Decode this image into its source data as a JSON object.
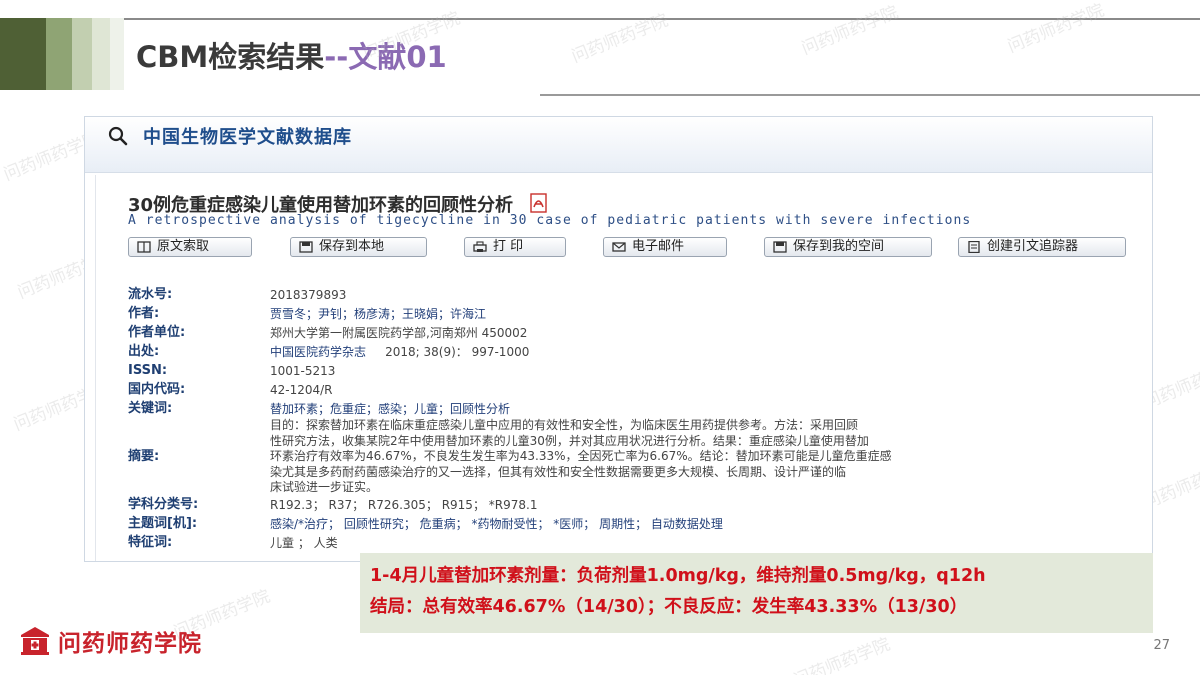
{
  "slide": {
    "title_main": "CBM检索结果",
    "title_sub": "--文献01",
    "page_number": "27",
    "watermark": "问药师药学院"
  },
  "database": {
    "title": "中国生物医学文献数据库"
  },
  "article": {
    "title_cn": "30例危重症感染儿童使用替加环素的回顾性分析",
    "title_en": "A retrospective analysis of tigecycline in 30 case of pediatric patients with severe infections"
  },
  "toolbar": {
    "buttons": [
      "原文索取",
      "保存到本地",
      "打 印",
      "电子邮件",
      "保存到我的空间",
      "创建引文追踪器"
    ]
  },
  "record": {
    "serial_label": "流水号:",
    "serial_value": "2018379893",
    "authors_label": "作者:",
    "authors_value": "贾雪冬；尹钊；杨彦涛；王晓娟；许海江",
    "affiliation_label": "作者单位:",
    "affiliation_value": "郑州大学第一附属医院药学部,河南郑州 450002",
    "source_label": "出处:",
    "source_journal": "中国医院药学杂志",
    "source_issue": "2018; 38(9)：  997-1000",
    "issn_label": "ISSN:",
    "issn_value": "1001-5213",
    "domestic_code_label": "国内代码:",
    "domestic_code_value": "42-1204/R",
    "keywords_label": "关键词:",
    "keywords_value": "替加环素；危重症；感染；儿童；回顾性分析",
    "abstract_label": "摘要:",
    "abstract_lines": [
      "目的：探索替加环素在临床重症感染儿童中应用的有效性和安全性，为临床医生用药提供参考。方法：采用回顾",
      "性研究方法，收集某院2年中使用替加环素的儿童30例，并对其应用状况进行分析。结果：重症感染儿童使用替加",
      "环素治疗有效率为46.67%，不良发生发生率为43.33%，全因死亡率为6.67%。结论：替加环素可能是儿童危重症感",
      "染尤其是多药耐药菌感染治疗的又一选择，但其有效性和安全性数据需要更多大规模、长周期、设计严谨的临",
      "床试验进一步证实。"
    ],
    "classification_label": "学科分类号:",
    "classification_value": "R192.3；  R37；  R726.305；  R915；  *R978.1",
    "subject_label": "主题词[机]:",
    "subject_value": "感染/*治疗；  回顾性研究；  危重病；  *药物耐受性；  *医师；  周期性；  自动数据处理",
    "feature_label": "特征词:",
    "feature_value": "儿童 ；  人类"
  },
  "summary": {
    "line1": "1-4月儿童替加环素剂量：负荷剂量1.0mg/kg，维持剂量0.5mg/kg，q12h",
    "line2": "结局：总有效率46.67%（14/30）；不良反应：发生率43.33%（13/30）"
  },
  "footer": {
    "logo_text": "问药师药学院"
  },
  "colors": {
    "accent_purple": "#8b6ab3",
    "summary_red": "#d0101a",
    "summary_bg": "#e3e9da",
    "logo_red": "#c8232c",
    "link_blue": "#1f4e8c"
  }
}
